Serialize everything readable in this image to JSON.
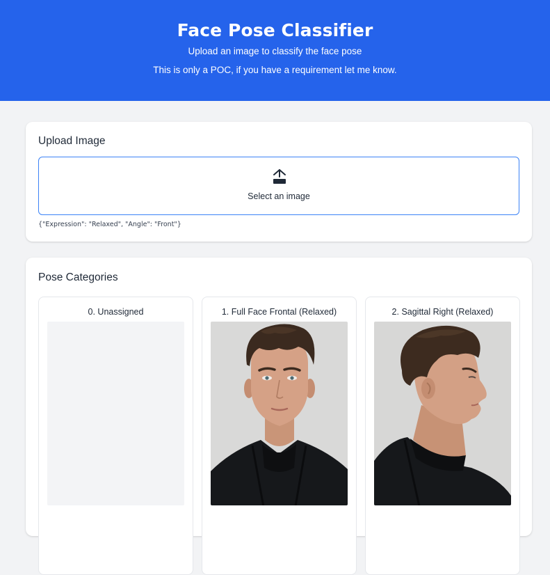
{
  "header": {
    "title": "Face Pose Classifier",
    "subtitle": "Upload an image to classify the face pose",
    "note": "This is only a POC, if you have a requirement let me know."
  },
  "upload": {
    "title": "Upload Image",
    "select_label": "Select an image",
    "icon": "upload-icon",
    "result": "{\"Expression\": \"Relaxed\", \"Angle\": \"Front\"}"
  },
  "pose_categories": {
    "title": "Pose Categories",
    "items": [
      {
        "label": "0. Unassigned"
      },
      {
        "label": "1. Full Face Frontal (Relaxed)"
      },
      {
        "label": "2. Sagittal Right (Relaxed)"
      }
    ]
  },
  "colors": {
    "header_bg": "#2563eb",
    "page_bg": "#f2f3f5",
    "accent_border": "#3b82f6"
  }
}
